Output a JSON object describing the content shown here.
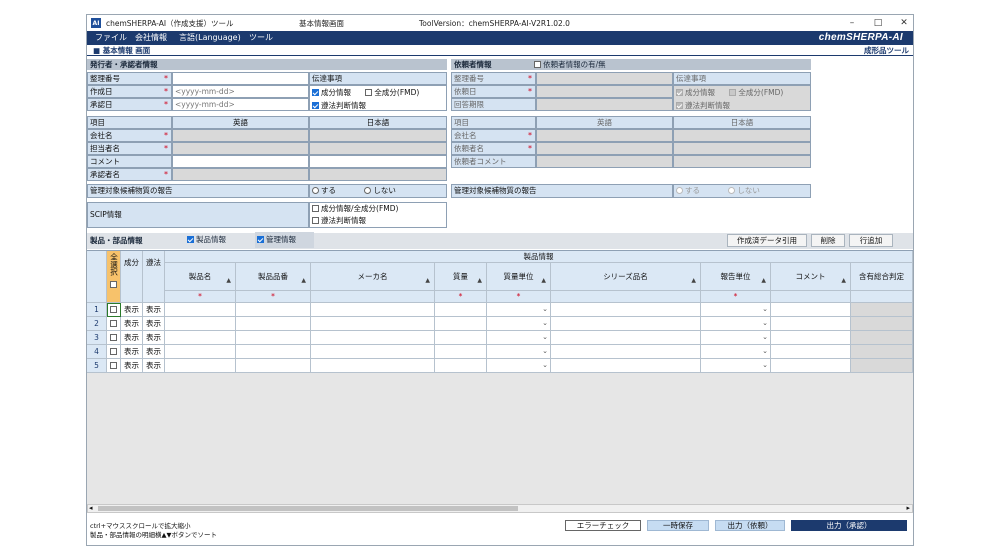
{
  "window": {
    "title": "chemSHERPA-AI（作成支援）ツール",
    "center": "基本情報画面",
    "version": "ToolVersion：chemSHERPA-AI-V2R1.02.0",
    "app_icon": "AI"
  },
  "menu": {
    "items": [
      "ファイル",
      "会社情報",
      "言語(Language)",
      "ツール"
    ],
    "brand": "chemSHERPA-AI"
  },
  "page": {
    "title": "■ 基本情報 画面",
    "tool_name": "成形品ツール"
  },
  "issuer": {
    "section_title": "発行者・承認者情報",
    "rows": [
      {
        "label": "整理番号",
        "value": ""
      },
      {
        "label": "作成日",
        "placeholder": "<yyyy-mm-dd>"
      },
      {
        "label": "承認日",
        "placeholder": "<yyyy-mm-dd>"
      }
    ],
    "notice_title": "伝達事項",
    "notice_items": [
      {
        "label": "成分情報",
        "checked": true
      },
      {
        "label": "全成分(FMD)",
        "checked": false
      },
      {
        "label": "遵法判断情報",
        "checked": true
      }
    ],
    "col_item": "項目",
    "col_en": "英語",
    "col_ja": "日本語",
    "fields": [
      "会社名",
      "担当者名",
      "コメント",
      "承認者名"
    ],
    "report_label": "管理対象候補物質の報告",
    "report_yes": "する",
    "report_no": "しない",
    "scip_label": "SCIP情報",
    "scip_items": [
      "成分情報/全成分(FMD)",
      "遵法判断情報"
    ]
  },
  "requester": {
    "section_title": "依頼者情報",
    "toggle_label": "依頼者情報の有/無",
    "rows": [
      "整理番号",
      "依頼日",
      "回答期限"
    ],
    "notice_title": "伝達事項",
    "notice_items": [
      "成分情報",
      "全成分(FMD)",
      "遵法判断情報"
    ],
    "col_item": "項目",
    "col_en": "英語",
    "col_ja": "日本語",
    "fields": [
      "会社名",
      "依頼者名",
      "依頼者コメント"
    ],
    "report_label": "管理対象候補物質の報告",
    "report_yes": "する",
    "report_no": "しない"
  },
  "products": {
    "section_title": "製品・部品情報",
    "toggle_product": "製品情報",
    "toggle_manage": "管理情報",
    "btn_copy": "作成済データ引用",
    "btn_delete": "削除",
    "btn_add": "行追加",
    "group_header": "製品情報",
    "select_all": "全選択",
    "col_component": "成分",
    "col_compliance": "遵法",
    "columns": [
      "製品名",
      "製品品番",
      "メーカ名",
      "質量",
      "質量単位",
      "シリーズ品名",
      "報告単位",
      "コメント",
      "含有総合判定"
    ],
    "show_label": "表示",
    "rows": [
      "1",
      "2",
      "3",
      "4",
      "5"
    ]
  },
  "footer": {
    "note1": "ctrl+マウススクロールで拡大縮小",
    "note2": "製品・部品情報の明細横▲▼ボタンでソート",
    "btn_error": "エラーチェック",
    "btn_save": "一時保存",
    "btn_out_req": "出力（依頼）",
    "btn_out_app": "出力（承認）"
  },
  "colors": {
    "navy": "#1c3a6e",
    "label_bg": "#d5e3f2",
    "section_bg": "#b9c3cf",
    "required": "#d0021b"
  }
}
